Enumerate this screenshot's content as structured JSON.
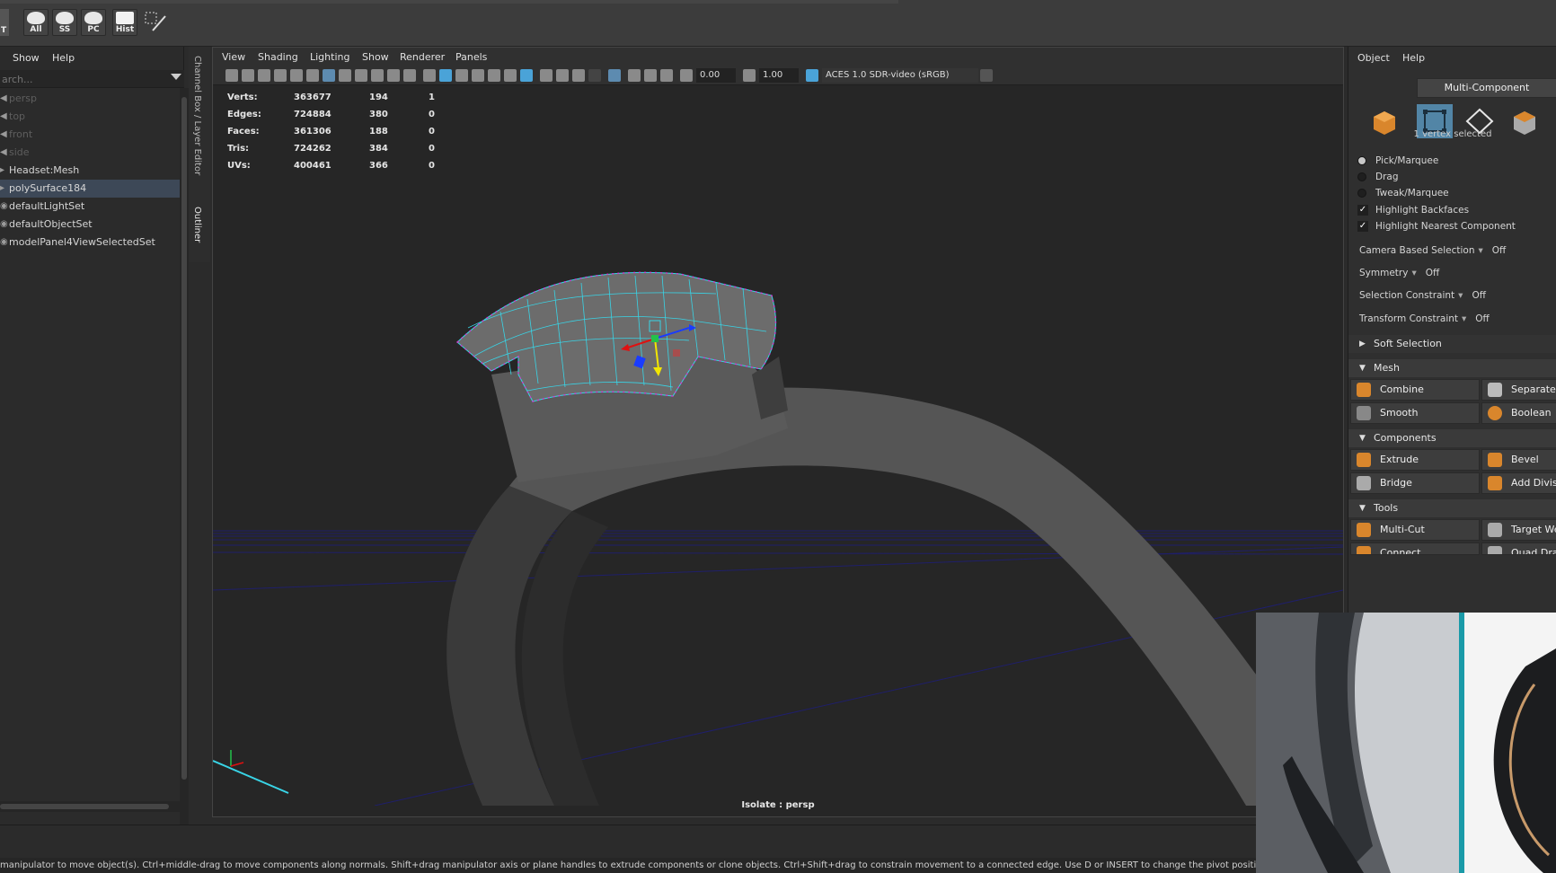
{
  "shelf": {
    "buttons": [
      {
        "label": "T"
      },
      {
        "label": "All"
      },
      {
        "label": "SS"
      },
      {
        "label": "PC"
      },
      {
        "label": "Hist"
      }
    ]
  },
  "outliner": {
    "menu": [
      "Show",
      "Help"
    ],
    "search_placeholder": "arch...",
    "items": [
      {
        "label": "persp",
        "dim": true
      },
      {
        "label": "top",
        "dim": true
      },
      {
        "label": "front",
        "dim": true
      },
      {
        "label": "side",
        "dim": true
      },
      {
        "label": "Headset:Mesh",
        "dim": false
      },
      {
        "label": "polySurface184",
        "dim": false,
        "selected": true
      },
      {
        "label": "defaultLightSet",
        "dim": false
      },
      {
        "label": "defaultObjectSet",
        "dim": false
      },
      {
        "label": "modelPanel4ViewSelectedSet",
        "dim": false
      }
    ]
  },
  "side_tabs": [
    "Channel Box / Layer Editor",
    "Outliner"
  ],
  "viewport": {
    "menu": [
      "View",
      "Shading",
      "Lighting",
      "Show",
      "Renderer",
      "Panels"
    ],
    "exposure": "0.00",
    "gamma": "1.00",
    "color_space": "ACES 1.0 SDR-video (sRGB)",
    "hud": [
      {
        "label": "Verts:",
        "total": "363677",
        "selected": "194",
        "components": "1"
      },
      {
        "label": "Edges:",
        "total": "724884",
        "selected": "380",
        "components": "0"
      },
      {
        "label": "Faces:",
        "total": "361306",
        "selected": "188",
        "components": "0"
      },
      {
        "label": "Tris:",
        "total": "724262",
        "selected": "384",
        "components": "0"
      },
      {
        "label": "UVs:",
        "total": "400461",
        "selected": "366",
        "components": "0"
      }
    ],
    "camera_label": "Isolate : persp"
  },
  "modeling_toolkit": {
    "menu": [
      "Object",
      "Help"
    ],
    "mode_label": "Multi-Component",
    "selection_info": "1 vertex selected",
    "selection_modes": [
      {
        "label": "Pick/Marquee",
        "on": true
      },
      {
        "label": "Drag",
        "on": false
      },
      {
        "label": "Tweak/Marquee",
        "on": false
      }
    ],
    "checks": [
      {
        "label": "Highlight Backfaces",
        "checked": true
      },
      {
        "label": "Highlight Nearest Component",
        "checked": true
      }
    ],
    "options": [
      {
        "label": "Camera Based Selection",
        "value": "Off"
      },
      {
        "label": "Symmetry",
        "value": "Off"
      },
      {
        "label": "Selection Constraint",
        "value": "Off"
      },
      {
        "label": "Transform Constraint",
        "value": "Off"
      }
    ],
    "soft_selection": "Soft Selection",
    "sections": {
      "mesh": "Mesh",
      "components": "Components",
      "tools": "Tools"
    },
    "mesh_tools": [
      "Combine",
      "Separate",
      "Smooth",
      "Boolean"
    ],
    "component_tools": [
      "Extrude",
      "Bevel",
      "Bridge",
      "Add Divisions"
    ],
    "tools": [
      "Multi-Cut",
      "Target Weld",
      "Connect",
      "Quad Draw"
    ]
  },
  "status_line": "manipulator to move object(s). Ctrl+middle-drag to move components along normals. Shift+drag manipulator axis or plane handles to extrude components or clone objects. Ctrl+Shift+drag to constrain movement to a connected edge. Use D or INSERT to change the pivot position and axis orientation.",
  "colors": {
    "selection_blue": "#5285a6",
    "wire_cyan": "#39d4e6",
    "vertex_magenta": "#d03ad0"
  }
}
